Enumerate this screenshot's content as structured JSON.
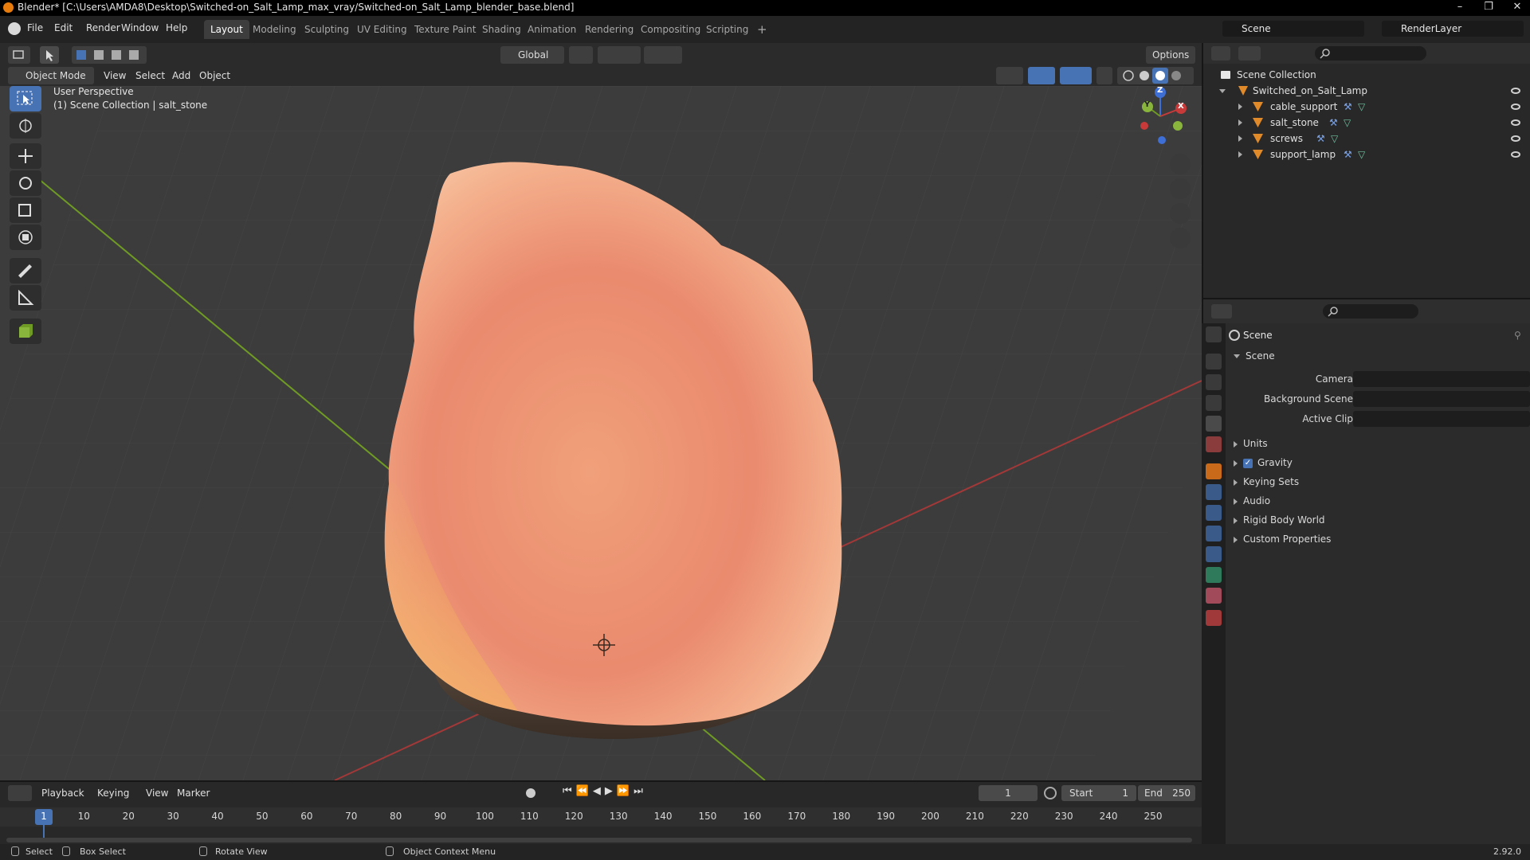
{
  "window": {
    "title": "Blender* [C:\\Users\\AMDA8\\Desktop\\Switched-on_Salt_Lamp_max_vray/Switched-on_Salt_Lamp_blender_base.blend]"
  },
  "menu": [
    "File",
    "Edit",
    "Render",
    "Window",
    "Help"
  ],
  "workspaces": [
    "Layout",
    "Modeling",
    "Sculpting",
    "UV Editing",
    "Texture Paint",
    "Shading",
    "Animation",
    "Rendering",
    "Compositing",
    "Scripting"
  ],
  "scene_field": "Scene",
  "renderlayer_field": "RenderLayer",
  "viewport_header": {
    "transform_orientation": "Global",
    "options_label": "Options",
    "mode": "Object Mode",
    "menus": [
      "View",
      "Select",
      "Add",
      "Object"
    ]
  },
  "viewport": {
    "perspective": "User Perspective",
    "collection_info": "(1) Scene Collection | salt_stone",
    "gizmo_axes": {
      "x": "X",
      "y": "Y",
      "z": "Z"
    },
    "colors": {
      "x_axis": "#a33838",
      "y_axis": "#6f9a24",
      "bg": "#3c3c3c"
    }
  },
  "outliner": {
    "root": "Scene Collection",
    "collection": "Switched_on_Salt_Lamp",
    "objects": [
      "cable_support",
      "salt_stone",
      "screws",
      "support_lamp"
    ]
  },
  "properties": {
    "header": "Scene",
    "section": "Scene",
    "fields": [
      {
        "label": "Camera"
      },
      {
        "label": "Background Scene"
      },
      {
        "label": "Active Clip"
      }
    ],
    "panels": [
      "Units",
      "Gravity",
      "Keying Sets",
      "Audio",
      "Rigid Body World",
      "Custom Properties"
    ]
  },
  "timeline": {
    "menus": [
      "Playback",
      "Keying",
      "View",
      "Marker"
    ],
    "current_frame": "1",
    "start_label": "Start",
    "start": "1",
    "end_label": "End",
    "end": "250",
    "ticks": [
      "1",
      "10",
      "20",
      "30",
      "40",
      "50",
      "60",
      "70",
      "80",
      "90",
      "100",
      "110",
      "120",
      "130",
      "140",
      "150",
      "160",
      "170",
      "180",
      "190",
      "200",
      "210",
      "220",
      "230",
      "240",
      "250"
    ]
  },
  "statusbar": {
    "select": "Select",
    "box_select": "Box Select",
    "rotate_view": "Rotate View",
    "context_menu": "Object Context Menu",
    "version": "2.92.0"
  }
}
